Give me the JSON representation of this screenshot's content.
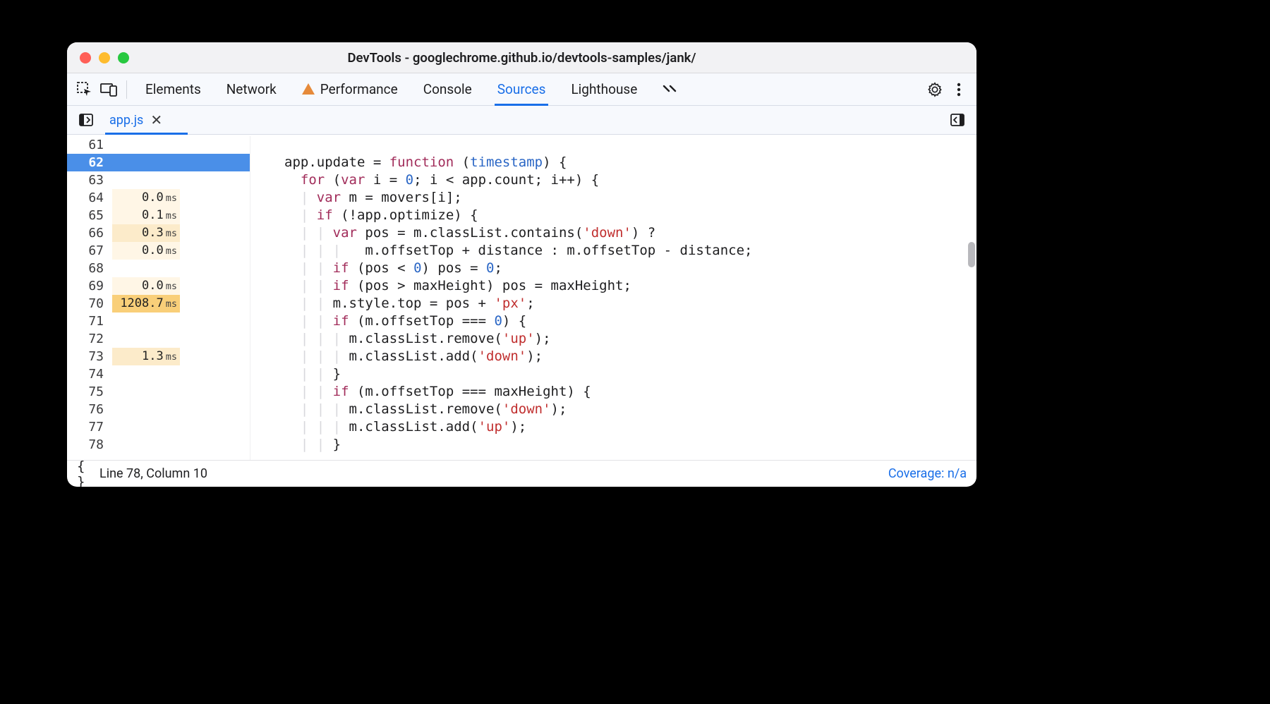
{
  "window": {
    "title": "DevTools - googlechrome.github.io/devtools-samples/jank/"
  },
  "toolbar": {
    "tabs": [
      {
        "label": "Elements",
        "active": false,
        "warn": false
      },
      {
        "label": "Network",
        "active": false,
        "warn": false
      },
      {
        "label": "Performance",
        "active": false,
        "warn": true
      },
      {
        "label": "Console",
        "active": false,
        "warn": false
      },
      {
        "label": "Sources",
        "active": true,
        "warn": false
      },
      {
        "label": "Lighthouse",
        "active": false,
        "warn": false
      }
    ]
  },
  "file_tab": {
    "name": "app.js"
  },
  "gutter": {
    "start": 61,
    "end": 78,
    "current_marker": 62,
    "timings": {
      "64": {
        "value": "0.0",
        "unit": "ms",
        "heat": 0
      },
      "65": {
        "value": "0.1",
        "unit": "ms",
        "heat": 0
      },
      "66": {
        "value": "0.3",
        "unit": "ms",
        "heat": 1
      },
      "67": {
        "value": "0.0",
        "unit": "ms",
        "heat": 0
      },
      "69": {
        "value": "0.0",
        "unit": "ms",
        "heat": 0
      },
      "70": {
        "value": "1208.7",
        "unit": "ms",
        "heat": 2
      },
      "73": {
        "value": "1.3",
        "unit": "ms",
        "heat": 1
      }
    }
  },
  "code": {
    "61": [
      {
        "t": "",
        "c": ""
      }
    ],
    "62": [
      {
        "t": "app.update = ",
        "c": ""
      },
      {
        "t": "function",
        "c": "fn"
      },
      {
        "t": " (",
        "c": ""
      },
      {
        "t": "timestamp",
        "c": "arg"
      },
      {
        "t": ") {",
        "c": ""
      }
    ],
    "63": [
      {
        "t": "  ",
        "c": ""
      },
      {
        "t": "for",
        "c": "kw"
      },
      {
        "t": " (",
        "c": ""
      },
      {
        "t": "var",
        "c": "kw"
      },
      {
        "t": " i = ",
        "c": ""
      },
      {
        "t": "0",
        "c": "num2"
      },
      {
        "t": "; i < app.count; i++) {",
        "c": ""
      }
    ],
    "64": [
      {
        "t": "  ",
        "c": ""
      },
      {
        "t": "| ",
        "c": "pipe"
      },
      {
        "t": "var",
        "c": "kw"
      },
      {
        "t": " m = movers[i];",
        "c": ""
      }
    ],
    "65": [
      {
        "t": "  ",
        "c": ""
      },
      {
        "t": "| ",
        "c": "pipe"
      },
      {
        "t": "if",
        "c": "kw"
      },
      {
        "t": " (!app.optimize) {",
        "c": ""
      }
    ],
    "66": [
      {
        "t": "  ",
        "c": ""
      },
      {
        "t": "| | ",
        "c": "pipe"
      },
      {
        "t": "var",
        "c": "kw"
      },
      {
        "t": " pos = m.classList.contains(",
        "c": ""
      },
      {
        "t": "'down'",
        "c": "str"
      },
      {
        "t": ") ?",
        "c": ""
      }
    ],
    "67": [
      {
        "t": "  ",
        "c": ""
      },
      {
        "t": "| | | ",
        "c": "pipe"
      },
      {
        "t": "  m.offsetTop + distance : m.offsetTop - distance;",
        "c": ""
      }
    ],
    "68": [
      {
        "t": "  ",
        "c": ""
      },
      {
        "t": "| | ",
        "c": "pipe"
      },
      {
        "t": "if",
        "c": "kw"
      },
      {
        "t": " (pos < ",
        "c": ""
      },
      {
        "t": "0",
        "c": "num2"
      },
      {
        "t": ") pos = ",
        "c": ""
      },
      {
        "t": "0",
        "c": "num2"
      },
      {
        "t": ";",
        "c": ""
      }
    ],
    "69": [
      {
        "t": "  ",
        "c": ""
      },
      {
        "t": "| | ",
        "c": "pipe"
      },
      {
        "t": "if",
        "c": "kw"
      },
      {
        "t": " (pos > maxHeight) pos = maxHeight;",
        "c": ""
      }
    ],
    "70": [
      {
        "t": "  ",
        "c": ""
      },
      {
        "t": "| | ",
        "c": "pipe"
      },
      {
        "t": "m.style.top = pos + ",
        "c": ""
      },
      {
        "t": "'px'",
        "c": "str"
      },
      {
        "t": ";",
        "c": ""
      }
    ],
    "71": [
      {
        "t": "  ",
        "c": ""
      },
      {
        "t": "| | ",
        "c": "pipe"
      },
      {
        "t": "if",
        "c": "kw"
      },
      {
        "t": " (m.offsetTop === ",
        "c": ""
      },
      {
        "t": "0",
        "c": "num2"
      },
      {
        "t": ") {",
        "c": ""
      }
    ],
    "72": [
      {
        "t": "  ",
        "c": ""
      },
      {
        "t": "| | | ",
        "c": "pipe"
      },
      {
        "t": "m.classList.remove(",
        "c": ""
      },
      {
        "t": "'up'",
        "c": "str"
      },
      {
        "t": ");",
        "c": ""
      }
    ],
    "73": [
      {
        "t": "  ",
        "c": ""
      },
      {
        "t": "| | | ",
        "c": "pipe"
      },
      {
        "t": "m.classList.add(",
        "c": ""
      },
      {
        "t": "'down'",
        "c": "str"
      },
      {
        "t": ");",
        "c": ""
      }
    ],
    "74": [
      {
        "t": "  ",
        "c": ""
      },
      {
        "t": "| | ",
        "c": "pipe"
      },
      {
        "t": "}",
        "c": ""
      }
    ],
    "75": [
      {
        "t": "  ",
        "c": ""
      },
      {
        "t": "| | ",
        "c": "pipe"
      },
      {
        "t": "if",
        "c": "kw"
      },
      {
        "t": " (m.offsetTop === maxHeight) {",
        "c": ""
      }
    ],
    "76": [
      {
        "t": "  ",
        "c": ""
      },
      {
        "t": "| | | ",
        "c": "pipe"
      },
      {
        "t": "m.classList.remove(",
        "c": ""
      },
      {
        "t": "'down'",
        "c": "str"
      },
      {
        "t": ");",
        "c": ""
      }
    ],
    "77": [
      {
        "t": "  ",
        "c": ""
      },
      {
        "t": "| | | ",
        "c": "pipe"
      },
      {
        "t": "m.classList.add(",
        "c": ""
      },
      {
        "t": "'up'",
        "c": "str"
      },
      {
        "t": ");",
        "c": ""
      }
    ],
    "78": [
      {
        "t": "  ",
        "c": ""
      },
      {
        "t": "| | ",
        "c": "pipe"
      },
      {
        "t": "}",
        "c": ""
      }
    ]
  },
  "status": {
    "cursor": "Line 78, Column 10",
    "coverage": "Coverage: n/a"
  }
}
